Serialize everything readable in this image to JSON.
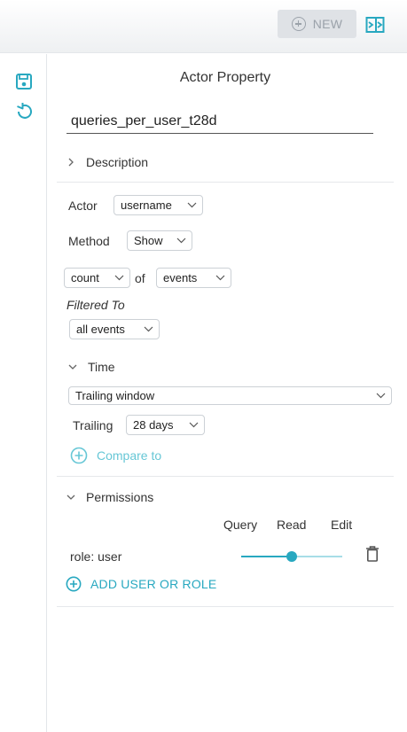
{
  "header": {
    "new_label": "NEW",
    "icons": {
      "new": "plus-circle-icon",
      "toggle": "panel-toggle-icon"
    },
    "colors": {
      "accent": "#28a8c0",
      "disabled": "#9ba2aa"
    }
  },
  "sidebar": {
    "icons": [
      "save-icon",
      "undo-icon"
    ]
  },
  "editor": {
    "title": "Actor Property",
    "name_value": "queries_per_user_t28d",
    "description_label": "Description",
    "actor": {
      "label": "Actor",
      "value": "username"
    },
    "method": {
      "label": "Method",
      "value": "Show"
    },
    "aggregate": {
      "func": "count",
      "of_label": "of",
      "target": "events"
    },
    "filter": {
      "label": "Filtered To",
      "value": "all events"
    },
    "time": {
      "label": "Time",
      "window": "Trailing window",
      "trailing_label": "Trailing",
      "trailing_value": "28 days",
      "compare_label": "Compare to"
    },
    "permissions": {
      "label": "Permissions",
      "columns": [
        "Query",
        "Read",
        "Edit"
      ],
      "rows": [
        {
          "role": "role: user",
          "level": "Read"
        }
      ],
      "add_label": "ADD USER OR ROLE"
    }
  }
}
